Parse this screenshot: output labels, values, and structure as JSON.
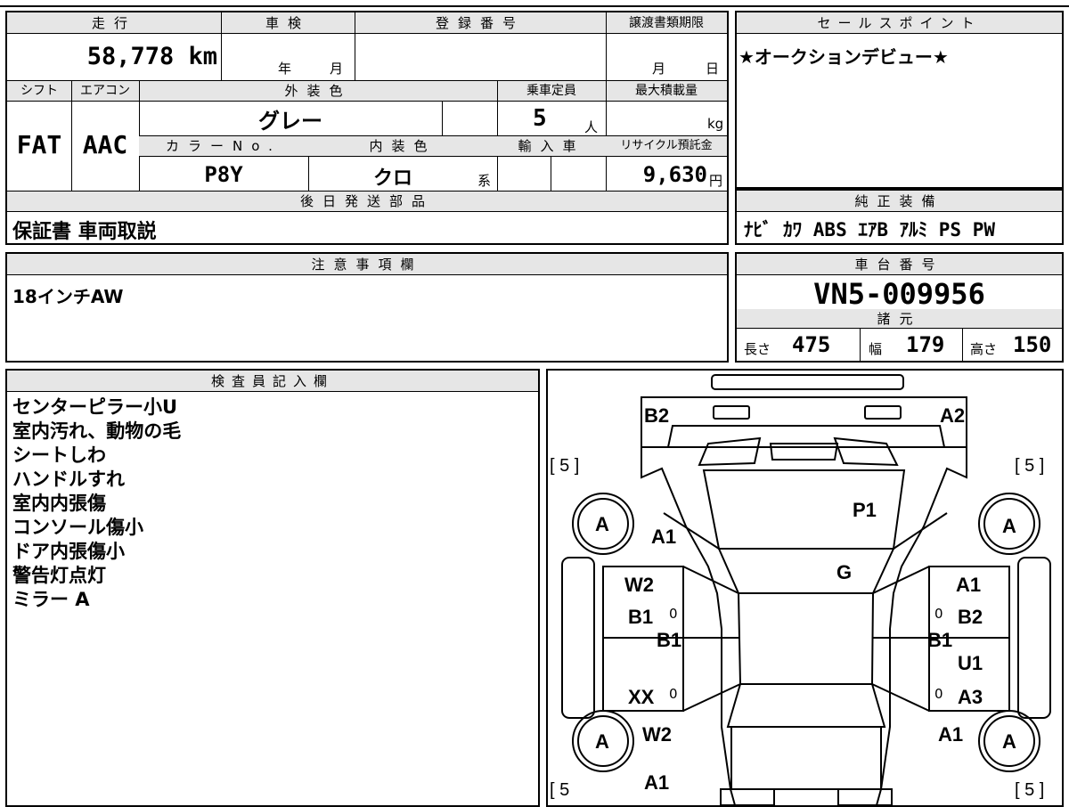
{
  "main_sheet": {
    "mileage": {
      "label": "走行",
      "value": "58,778 km"
    },
    "inspection": {
      "label": "車検",
      "year_unit": "年",
      "month_unit": "月"
    },
    "registration_number": {
      "label": "登録番号"
    },
    "transfer_deadline": {
      "label": "譲渡書類期限",
      "month_unit": "月",
      "day_unit": "日"
    },
    "shift": {
      "label": "シフト",
      "value": "FAT"
    },
    "aircon": {
      "label": "エアコン",
      "value": "AAC"
    },
    "exterior_color": {
      "label": "外装色",
      "value": "グレー"
    },
    "capacity": {
      "label": "乗車定員",
      "value": "5",
      "unit": "人"
    },
    "max_load": {
      "label": "最大積載量",
      "unit": "kg"
    },
    "color_no": {
      "label": "カラーNo.",
      "value": "P8Y"
    },
    "interior_color": {
      "label": "内装色",
      "value": "クロ",
      "suffix": "系"
    },
    "import": {
      "label": "輸入車"
    },
    "recycle_fee": {
      "label": "リサイクル預託金",
      "value": "9,630",
      "unit": "円"
    },
    "later_parts": {
      "label": "後日発送部品",
      "value": "保証書 車両取説"
    }
  },
  "sales_point": {
    "label": "セールスポイント",
    "text": "★オークションデビュー★"
  },
  "genuine_equipment": {
    "label": "純正装備",
    "text": "ﾅﾋﾞ ｶﾜ ABS ｴｱB ｱﾙﾐ PS PW"
  },
  "caution": {
    "label": "注意事項欄",
    "text": "18インチAW"
  },
  "chassis": {
    "label": "車台番号",
    "value": "VN5-009956"
  },
  "specs": {
    "label": "諸元",
    "length_label": "長さ",
    "length": "475",
    "width_label": "幅",
    "width": "179",
    "height_label": "高さ",
    "height": "150"
  },
  "inspector": {
    "label": "検査員記入欄",
    "lines": [
      "センターピラー小U",
      "室内汚れ、動物の毛",
      "シートしわ",
      "ハンドルすれ",
      "室内内張傷",
      "コンソール傷小",
      "ドア内張傷小",
      "警告灯点灯",
      "ミラー A"
    ]
  },
  "diagram": {
    "tire_front_left": "[ 5 ]",
    "tire_front_right": "[ 5 ]",
    "tire_rear_left": "[ 5",
    "tire_rear_right": "[ 5 ]",
    "wheel": "A",
    "marks": {
      "b2_top": "B2",
      "a2_top": "A2",
      "p1": "P1",
      "g": "G",
      "a1_left_front": "A1",
      "w2_left": "W2",
      "b1_left": "B1",
      "b1_left_sill": "B1",
      "xx_left": "XX",
      "w2_left_rear": "W2",
      "a1_left_rear": "A1",
      "a1_right_front": "A1",
      "b2_right": "B2",
      "b1_right_sill": "B1",
      "u1_right": "U1",
      "a3_right": "A3",
      "a1_right_rear": "A1",
      "zero": "0"
    }
  }
}
